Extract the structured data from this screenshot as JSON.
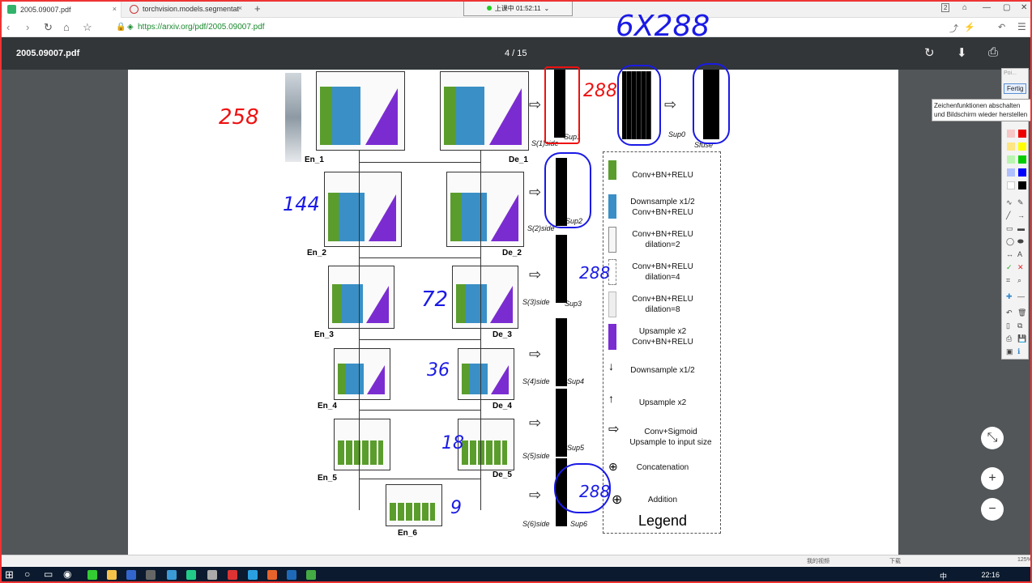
{
  "browser": {
    "tabs": [
      {
        "label": "2005.09007.pdf",
        "close": "×"
      },
      {
        "label": "torchvision.models.segmentat",
        "close": "×"
      }
    ],
    "new_tab": "+",
    "clock": "上课中 01:52:11",
    "clock_chevron": "⌄",
    "tab_count": "2",
    "url": "https://arxiv.org/pdf/2005.09007.pdf",
    "icons": {
      "back": "‹",
      "forward": "›",
      "reload": "↻",
      "home": "⌂",
      "star": "☆",
      "lock": "🔒",
      "shield": "◈",
      "share": "⤴",
      "extension": "⚡",
      "undo": "↶",
      "menu": "☰",
      "bookmark": "⌂",
      "minimize": "—",
      "maximize": "▢",
      "close": "✕"
    }
  },
  "pdf": {
    "title": "2005.09007.pdf",
    "page_indicator": "4 / 15",
    "icons": {
      "rotate": "↻",
      "download": "⬇",
      "print": "⎙",
      "fit": "⤡",
      "zoom_in": "+",
      "zoom_out": "−"
    }
  },
  "figure": {
    "en": [
      "En_1",
      "En_2",
      "En_3",
      "En_4",
      "En_5",
      "En_6"
    ],
    "de": [
      "De_1",
      "De_2",
      "De_3",
      "De_4",
      "De_5"
    ],
    "sides": [
      "S(1)side",
      "S(2)side",
      "S(3)side",
      "S(4)side",
      "S(5)side",
      "S(6)side"
    ],
    "fuse": "Sfuse",
    "sups": [
      "Sup0",
      "Sup1",
      "Sup2",
      "Sup3",
      "Sup4",
      "Sup5",
      "Sup6"
    ],
    "arrow": "⇨"
  },
  "legend": {
    "title": "Legend",
    "items": [
      "Conv+BN+RELU",
      "Downsample x1/2\nConv+BN+RELU",
      "Conv+BN+RELU\ndilation=2",
      "Conv+BN+RELU\ndilation=4",
      "Conv+BN+RELU\ndilation=8",
      "Upsample x2\nConv+BN+RELU",
      "Downsample x1/2",
      "Upsample x2",
      "Conv+Sigmoid\nUpsample to input size",
      "Concatenation",
      "Addition"
    ],
    "icons": {
      "down": "↓",
      "up": "↑",
      "right": "⇨",
      "concat": "⊕",
      "add": "⊕"
    }
  },
  "handwriting": {
    "h258": "258",
    "h144": "144",
    "h72": "72",
    "h36": "36",
    "h18": "18",
    "h9": "9",
    "top": "6X288",
    "h288a": "288",
    "h288b": "288",
    "h288c": "288"
  },
  "drawtool": {
    "title": "Poi...",
    "done": "Fertig",
    "tooltip": [
      "Zeichenfunktionen abschalten",
      "und Bildschirm wieder herstellen"
    ],
    "icons": {
      "pen": "∿",
      "marker": "✎",
      "line": "╱",
      "arrow": "→",
      "rect": "▭",
      "rectfill": "▬",
      "ellipse": "◯",
      "ellipsefill": "⬬",
      "dbl": "↔",
      "text": "A",
      "check": "✓",
      "cross": "✕",
      "crop": "⌗",
      "zoom": "⌕",
      "plus": "✚",
      "minus": "—",
      "undo": "↶",
      "trash": "🗑",
      "page": "▯",
      "copy": "⧉",
      "print": "⎙",
      "save": "💾",
      "image": "▣",
      "info": "ℹ"
    }
  },
  "status": {
    "items": [
      "我的视频",
      "下载"
    ],
    "zoom": "125%"
  },
  "taskbar": {
    "icons": {
      "start": "⊞",
      "search": "○",
      "taskview": "▭",
      "app": "◉"
    },
    "ime": "中",
    "time": "22:16"
  }
}
